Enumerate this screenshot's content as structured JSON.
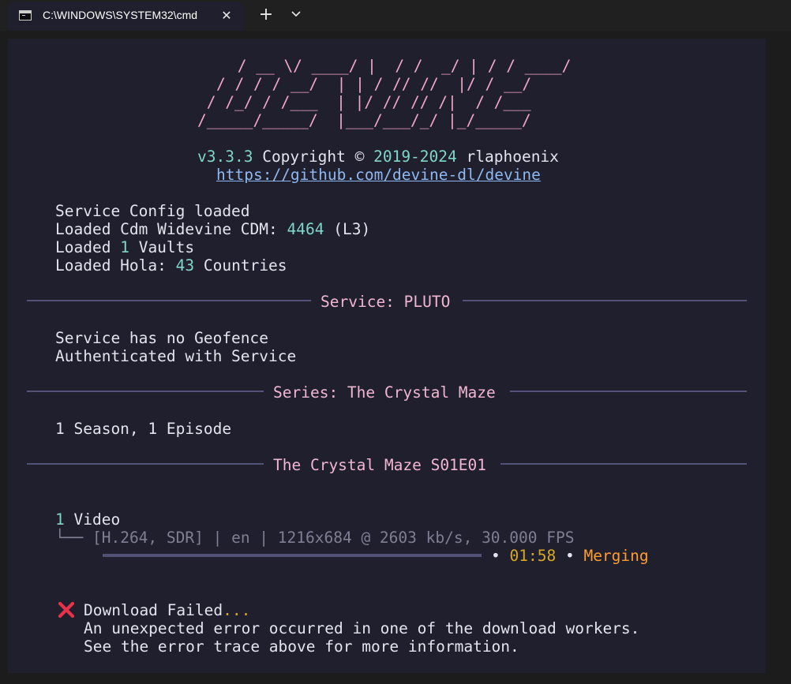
{
  "tab": {
    "title": "C:\\WINDOWS\\SYSTEM32\\cmd"
  },
  "icons": {
    "tab_icon": "console-icon",
    "close": "close-icon",
    "new_tab": "plus-icon",
    "dropdown": "chevron-down-icon",
    "fail": "cross-mark-icon"
  },
  "colors": {
    "window": "#202020",
    "terminal_bg": "#1f1f2d",
    "pink": "#f2b6d3",
    "teal": "#80d6c8",
    "link": "#8fb8f0",
    "orange": "#ff9c2e",
    "fail": "#e8324a"
  },
  "console": {
    "logo": [
      " / __ \\/ ____/ |  / /  _/ | / / ____/",
      "/ / / / __/  | | / // //  |/ / __/",
      " / /_/ / /___  | |/ // // /|  / /___",
      "/_____/_____/  |___/___/_/ |_/_____/"
    ],
    "version": "v3.3.3",
    "copyright_word": "Copyright ©",
    "years": "2019-2024",
    "author": "rlaphoenix",
    "url": "https://github.com/devine-dl/devine",
    "service_config": "Service Config loaded",
    "cdm_prefix": "Loaded Cdm Widevine CDM:",
    "cdm_id": "4464",
    "cdm_level": "(L3)",
    "vaults_prefix": "Loaded",
    "vaults_count": "1",
    "vaults_suffix": "Vaults",
    "hola_prefix": "Loaded Hola:",
    "hola_count": "43",
    "hola_suffix": "Countries",
    "service_heading": "Service: PLUTO",
    "geofence": "Service has no Geofence",
    "auth": "Authenticated with Service",
    "series_heading": "Series: The Crystal Maze",
    "seasons": "1 Season, 1 Episode",
    "episode_heading": "The Crystal Maze S01E01",
    "video_count": "1",
    "video_label": "Video",
    "tree_connector": "└──",
    "track_info": "[H.264, SDR] | en | 1216x684 @ 2603 kb/s, 30.000 FPS",
    "bullet": "•",
    "elapsed": "01:58",
    "status": "Merging",
    "fail_title": "Download Failed",
    "fail_ellipsis": "...",
    "error_line1": "An unexpected error occurred in one of the download workers.",
    "error_line2": "See the error trace above for more information."
  }
}
